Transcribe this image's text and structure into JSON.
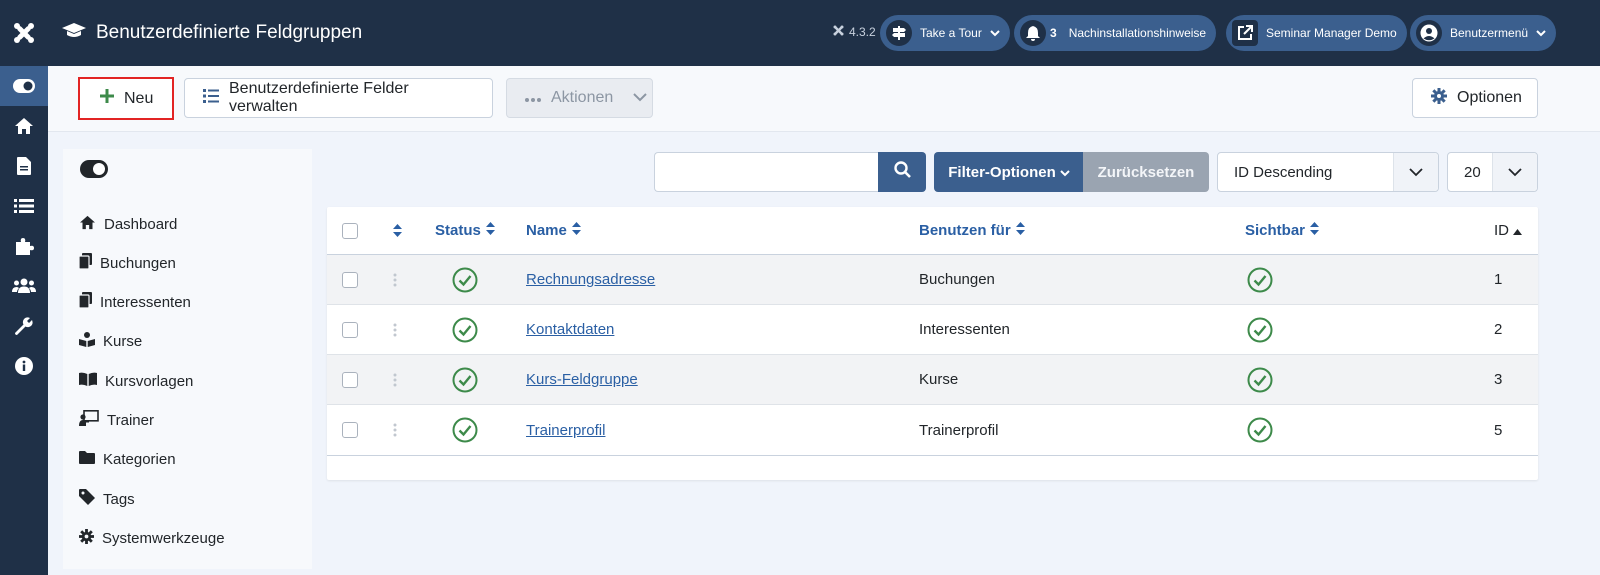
{
  "header": {
    "title": "Benutzerdefinierte Feldgruppen",
    "version": "4.3.2",
    "tour_label": "Take a Tour",
    "notifications_count": "3",
    "notifications_label": "Nachinstallationshinweise",
    "site_label": "Seminar Manager Demo",
    "user_menu_label": "Benutzermenü"
  },
  "toolbar": {
    "new_label": "Neu",
    "manage_fields_label": "Benutzerdefinierte Felder verwalten",
    "actions_label": "Aktionen",
    "options_label": "Optionen"
  },
  "sidebar": {
    "items": [
      {
        "label": "Dashboard",
        "icon": "home-icon"
      },
      {
        "label": "Buchungen",
        "icon": "copy-icon"
      },
      {
        "label": "Interessenten",
        "icon": "copy-icon"
      },
      {
        "label": "Kurse",
        "icon": "reader-icon"
      },
      {
        "label": "Kursvorlagen",
        "icon": "book-open-icon"
      },
      {
        "label": "Trainer",
        "icon": "chalkboard-teacher-icon"
      },
      {
        "label": "Kategorien",
        "icon": "folder-icon"
      },
      {
        "label": "Tags",
        "icon": "tag-icon"
      },
      {
        "label": "Systemwerkzeuge",
        "icon": "cog-icon"
      }
    ]
  },
  "filters": {
    "search_placeholder": "",
    "filter_options_label": "Filter-Optionen",
    "reset_label": "Zurücksetzen",
    "order_value": "ID Descending",
    "limit_value": "20"
  },
  "table": {
    "columns": {
      "status": "Status",
      "name": "Name",
      "used_for": "Benutzen für",
      "visible": "Sichtbar",
      "id": "ID"
    },
    "rows": [
      {
        "name": "Rechnungsadresse",
        "used_for": "Buchungen",
        "id": "1"
      },
      {
        "name": "Kontaktdaten",
        "used_for": "Interessenten",
        "id": "2"
      },
      {
        "name": "Kurs-Feldgruppe",
        "used_for": "Kurse",
        "id": "3"
      },
      {
        "name": "Trainerprofil",
        "used_for": "Trainerprofil",
        "id": "5"
      }
    ]
  },
  "colors": {
    "header_bg": "#1f3047",
    "accent": "#3b5f8e",
    "link": "#2a5fa4",
    "success": "#3d8a4a",
    "highlight": "#e22424"
  }
}
